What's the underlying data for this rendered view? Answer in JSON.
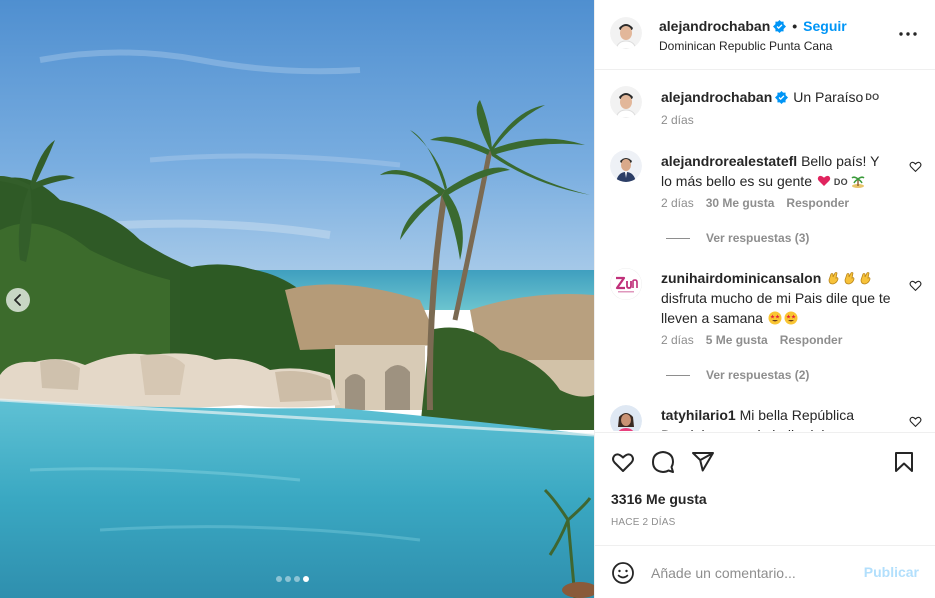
{
  "post": {
    "username": "alejandrochaban",
    "follow_label": "Seguir",
    "separator": "•",
    "location": "Dominican Republic Punta Cana",
    "caption_text": "Un Paraíso",
    "caption_flag": "DO",
    "caption_time": "2 días",
    "carousel": {
      "total": 4,
      "active_index": 4
    }
  },
  "comments": [
    {
      "username": "alejandrorealestatefl",
      "text": "Bello país! Y lo más bello es su gente",
      "flag": "DO",
      "emojis": [
        "heart-emoji",
        "palm-island-emoji"
      ],
      "time": "2 días",
      "likes": "30 Me gusta",
      "reply_label": "Responder",
      "view_replies": "Ver respuestas (3)"
    },
    {
      "username": "zunihairdominicansalon",
      "text": "disfruta mucho de mi Pais dile que te lleven a samana",
      "emojis_before": [
        "clap-emoji",
        "clap-emoji",
        "clap-emoji"
      ],
      "emojis_after": [
        "star-eyes-emoji",
        "star-eyes-emoji"
      ],
      "time": "2 días",
      "likes": "5 Me gusta",
      "reply_label": "Responder",
      "view_replies": "Ver respuestas (2)"
    },
    {
      "username": "tatyhilario1",
      "text": "Mi bella República Dominicana es lo bello del"
    }
  ],
  "stats": {
    "likes": "3316 Me gusta",
    "date": "HACE 2 DÍAS"
  },
  "composer": {
    "placeholder": "Añade un comentario...",
    "publish_label": "Publicar"
  },
  "colors": {
    "accent": "#0095f6",
    "accent_disabled": "#b2dffc",
    "muted_text": "#8e8e8e",
    "border": "#efefef",
    "verified": "#0095f6"
  }
}
